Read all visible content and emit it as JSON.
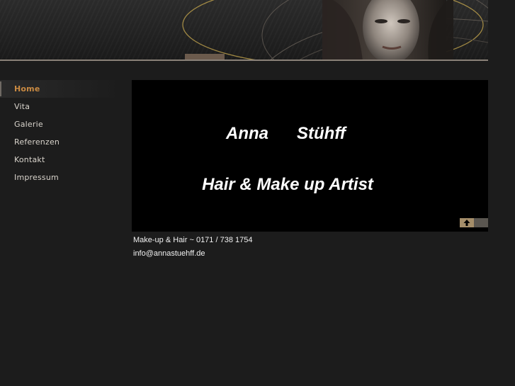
{
  "nav": {
    "items": [
      {
        "label": "Home",
        "active": true
      },
      {
        "label": "Vita",
        "active": false
      },
      {
        "label": "Galerie",
        "active": false
      },
      {
        "label": "Referenzen",
        "active": false
      },
      {
        "label": "Kontakt",
        "active": false
      },
      {
        "label": "Impressum",
        "active": false
      }
    ]
  },
  "stage": {
    "first_name": "Anna",
    "last_name": "Stühff",
    "tagline": "Hair & Make up Artist"
  },
  "footer": {
    "phone_line": "Make-up & Hair ~ 0171 / 738 1754",
    "email": "info@annastuehff.de"
  },
  "colors": {
    "accent": "#c98a42",
    "background": "#1c1c1c",
    "stage": "#000000",
    "up_button": "#a58e6a"
  },
  "icons": {
    "up_button": "arrow-up-icon"
  }
}
